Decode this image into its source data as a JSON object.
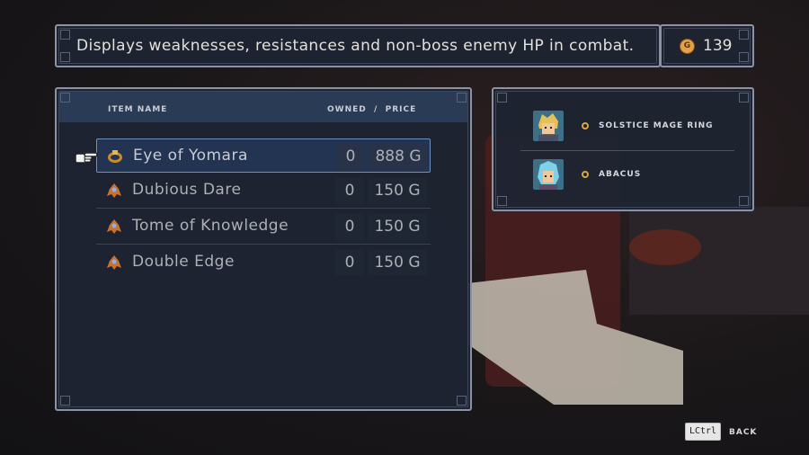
{
  "description": "Displays weaknesses, resistances and non-boss enemy HP in combat.",
  "gold": {
    "icon": "gold-coin-icon",
    "coin_letter": "G",
    "amount": "139"
  },
  "shop": {
    "headers": {
      "item_name": "ITEM NAME",
      "owned": "OWNED",
      "separator": "/",
      "price": "PRICE"
    },
    "items": [
      {
        "name": "Eye of Yomara",
        "owned": "0",
        "price": "888 G",
        "icon": "ring-icon",
        "selected": true
      },
      {
        "name": "Dubious Dare",
        "owned": "0",
        "price": "150 G",
        "icon": "relic-icon",
        "selected": false
      },
      {
        "name": "Tome of Knowledge",
        "owned": "0",
        "price": "150 G",
        "icon": "relic-icon",
        "selected": false
      },
      {
        "name": "Double Edge",
        "owned": "0",
        "price": "150 G",
        "icon": "relic-icon",
        "selected": false
      }
    ]
  },
  "party": [
    {
      "equipped": "SOLSTICE MAGE RING",
      "portrait": "blonde-hero-portrait"
    },
    {
      "equipped": "ABACUS",
      "portrait": "blue-hair-hero-portrait"
    }
  ],
  "controls": {
    "key": "LCtrl",
    "action": "BACK"
  },
  "colors": {
    "panel": "#1e2432",
    "border": "#8a93a6",
    "header": "#2a3b55",
    "selection": "#6e8fc0",
    "gold": "#e3a24a"
  }
}
